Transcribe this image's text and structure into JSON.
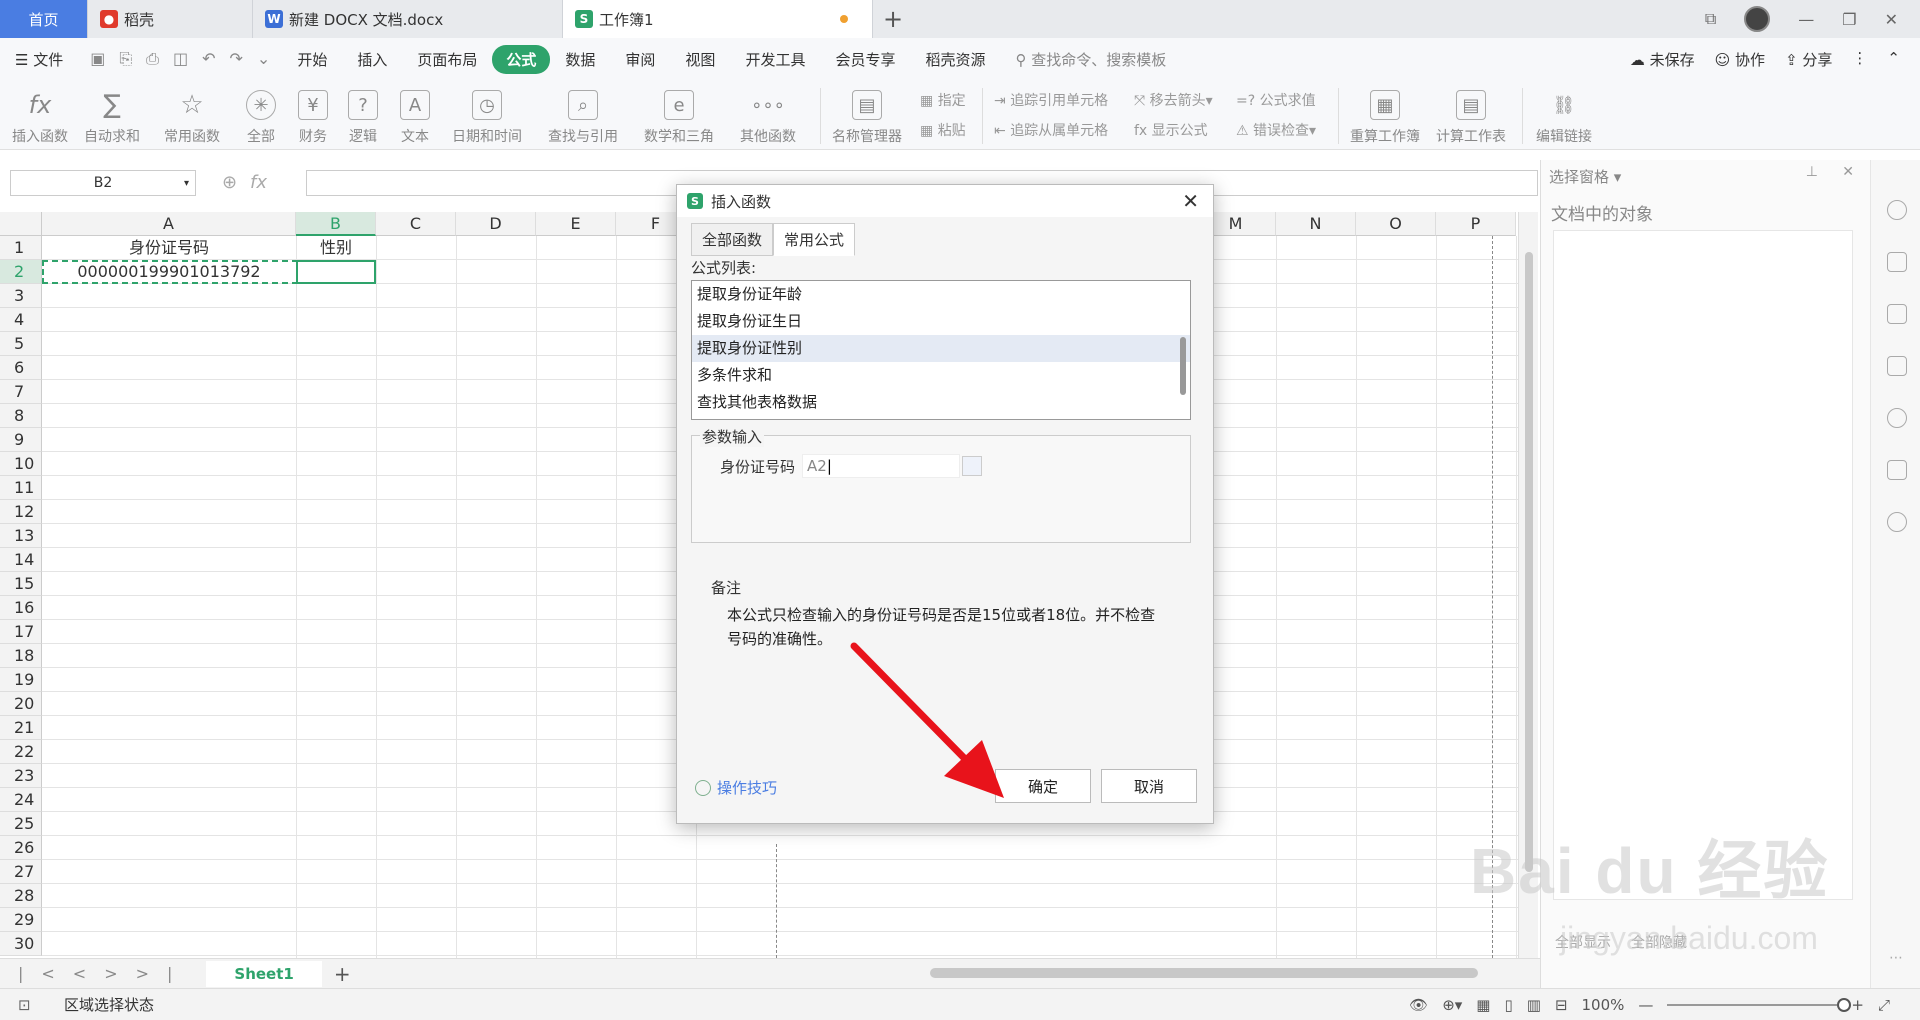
{
  "tabs": {
    "home": "首页",
    "daoke": "稻壳",
    "docx": "新建 DOCX 文档.docx",
    "workbook": "工作簿1"
  },
  "menu": {
    "file": "文件",
    "items": [
      "开始",
      "插入",
      "页面布局",
      "公式",
      "数据",
      "审阅",
      "视图",
      "开发工具",
      "会员专享",
      "稻壳资源"
    ],
    "active": "公式",
    "search": "查找命令、搜索模板",
    "unsaved": "未保存",
    "collab": "协作",
    "share": "分享"
  },
  "ribbon": {
    "insert_fn": "插入函数",
    "autosum": "自动求和",
    "common": "常用函数",
    "all": "全部",
    "finance": "财务",
    "logic": "逻辑",
    "text": "文本",
    "datetime": "日期和时间",
    "lookup": "查找与引用",
    "math": "数学和三角",
    "other": "其他函数",
    "name_mgr": "名称管理器",
    "specify": "指定",
    "paste": "粘贴",
    "trace_pre": "追踪引用单元格",
    "trace_dep": "追踪从属单元格",
    "remove_arrow": "移去箭头",
    "show_formula": "显示公式",
    "formula_eval": "公式求值",
    "error_check": "错误检查",
    "recalc_book": "重算工作簿",
    "calc_sheet": "计算工作表",
    "edit_links": "编辑链接"
  },
  "formula_bar": {
    "name_box": "B2",
    "fx": "fx"
  },
  "grid": {
    "columns": [
      "A",
      "B",
      "C",
      "D",
      "E",
      "F",
      "M",
      "N",
      "O",
      "P"
    ],
    "rows": [
      "1",
      "2",
      "3",
      "4",
      "5",
      "6",
      "7",
      "8",
      "9",
      "10",
      "11",
      "12",
      "13",
      "14",
      "15",
      "16",
      "17",
      "18",
      "19",
      "20",
      "21",
      "22",
      "23",
      "24",
      "25",
      "26",
      "27",
      "28",
      "29",
      "30"
    ],
    "a1": "身份证号码",
    "b1": "性别",
    "a2": "000000199901013792"
  },
  "sheet": {
    "tab": "Sheet1",
    "add": "+"
  },
  "status": {
    "text": "区域选择状态",
    "zoom": "100%"
  },
  "right_panel": {
    "title": "选择窗格",
    "subtitle": "文档中的对象",
    "show_all": "全部显示",
    "hide_all": "全部隐藏"
  },
  "dialog": {
    "title": "插入函数",
    "tab_all": "全部函数",
    "tab_common": "常用公式",
    "list_label": "公式列表:",
    "items": [
      "提取身份证年龄",
      "提取身份证生日",
      "提取身份证性别",
      "多条件求和",
      "查找其他表格数据"
    ],
    "selected_index": 2,
    "param_group": "参数输入",
    "param_label": "身份证号码",
    "param_value": "A2",
    "notes_title": "备注",
    "notes_body": "本公式只检查输入的身份证号码是否是15位或者18位。并不检查号码的准确性。",
    "tips": "操作技巧",
    "ok": "确定",
    "cancel": "取消"
  },
  "watermark": {
    "brand": "Bai du 经验",
    "url": "jingyan.baidu.com"
  },
  "colors": {
    "accent_green": "#2ea36b",
    "home_tab_blue": "#4a7de2",
    "arrow_red": "#e8131b"
  }
}
